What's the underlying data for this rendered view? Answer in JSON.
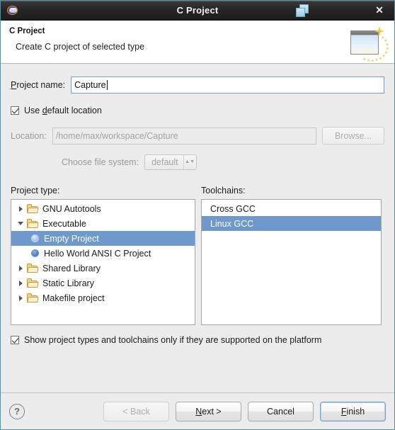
{
  "window": {
    "title": "C Project",
    "app_icon": "eclipse-icon",
    "restore_icon": "restore-windows-icon",
    "close_icon": "close-icon"
  },
  "banner": {
    "title": "C Project",
    "subtitle": "Create C project of selected type",
    "icon": "new-project-wizard-icon"
  },
  "form": {
    "project_name_label": "Project name:",
    "project_name_label_mnemonic": "P",
    "project_name_value": "Capture",
    "project_name_placeholder": "",
    "use_default_location_label": "Use default location",
    "use_default_location_mnemonic": "d",
    "use_default_location_checked": true,
    "location_label": "Location:",
    "location_value": "/home/max/workspace/Capture",
    "location_disabled": true,
    "browse_label": "Browse...",
    "browse_disabled": true,
    "file_system_label": "Choose file system:",
    "file_system_value": "default",
    "file_system_disabled": true
  },
  "project_type": {
    "label": "Project type:",
    "items": [
      {
        "label": "GNU Autotools",
        "icon": "folder-icon",
        "level": 1,
        "expanded": false,
        "has_twisty": true,
        "selected": false
      },
      {
        "label": "Executable",
        "icon": "folder-icon",
        "level": 1,
        "expanded": true,
        "has_twisty": true,
        "selected": false
      },
      {
        "label": "Empty Project",
        "icon": "disc-icon",
        "level": 2,
        "has_twisty": false,
        "selected": true
      },
      {
        "label": "Hello World ANSI C Project",
        "icon": "disc-icon",
        "level": 2,
        "has_twisty": false,
        "selected": false
      },
      {
        "label": "Shared Library",
        "icon": "folder-icon",
        "level": 1,
        "expanded": false,
        "has_twisty": true,
        "selected": false
      },
      {
        "label": "Static Library",
        "icon": "folder-icon",
        "level": 1,
        "expanded": false,
        "has_twisty": true,
        "selected": false
      },
      {
        "label": "Makefile project",
        "icon": "folder-icon",
        "level": 1,
        "expanded": false,
        "has_twisty": true,
        "selected": false
      }
    ]
  },
  "toolchains": {
    "label": "Toolchains:",
    "items": [
      {
        "label": "Cross GCC",
        "selected": false
      },
      {
        "label": "Linux GCC",
        "selected": true
      }
    ]
  },
  "show_supported": {
    "label": "Show project types and toolchains only if they are supported on the platform",
    "checked": true
  },
  "footer": {
    "help_icon": "help-icon",
    "help_glyph": "?",
    "back_label": "< Back",
    "back_disabled": true,
    "next_label": "Next >",
    "next_mnemonic": "N",
    "cancel_label": "Cancel",
    "finish_label": "Finish",
    "finish_mnemonic": "F",
    "finish_default": true
  },
  "colors": {
    "selection_blue": "#6f99cc",
    "window_bg": "#ececec",
    "titlebar_dark": "#262626",
    "window_border": "#5d8ea0",
    "focus_border": "#7a9ec4",
    "folder_gold": "#c79b3e"
  }
}
